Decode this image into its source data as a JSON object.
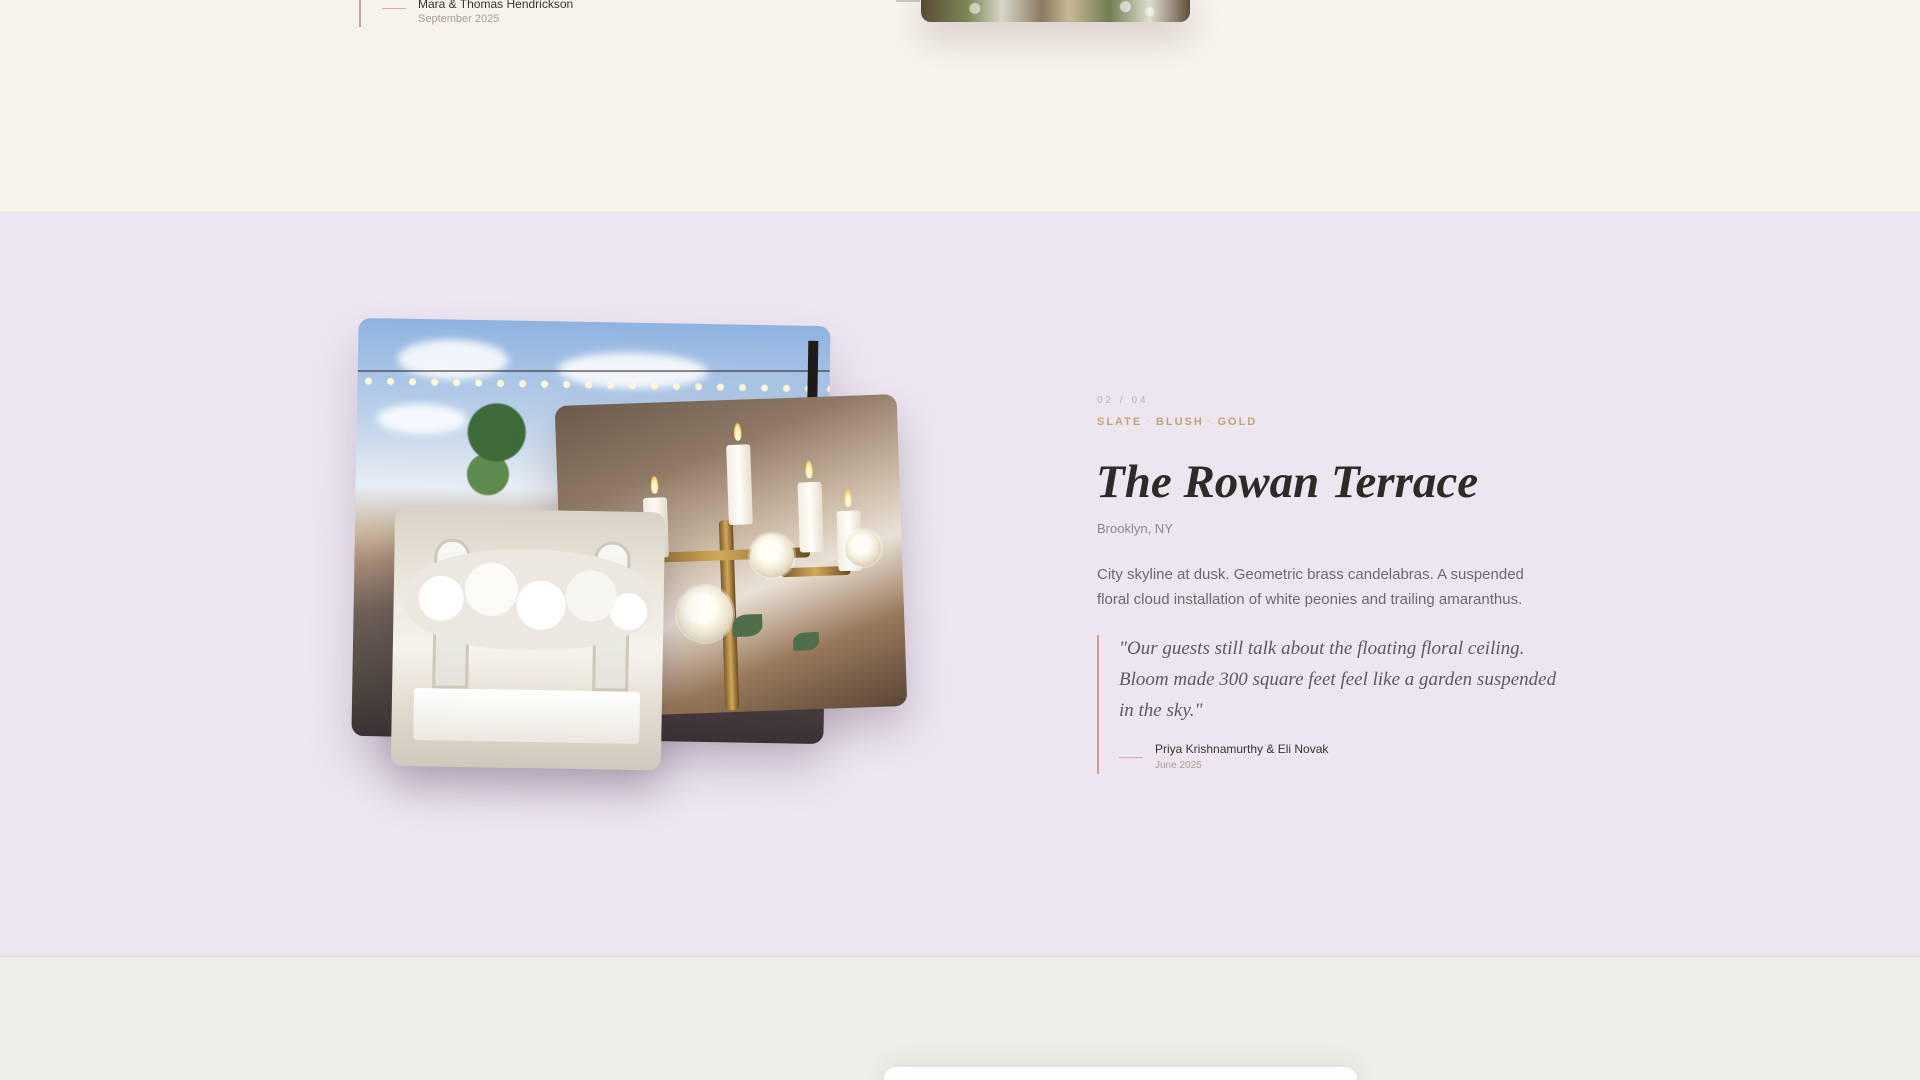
{
  "previous_testimonial": {
    "author": "Mara & Thomas Hendrickson",
    "date": "September 2025"
  },
  "venue": {
    "counter": "02 / 04",
    "palette": [
      "SLATE",
      "BLUSH",
      "GOLD"
    ],
    "palette_separator": "·",
    "name": "The Rowan Terrace",
    "location": "Brooklyn, NY",
    "description": "City skyline at dusk. Geometric brass candelabras. A suspended floral cloud installation of white peonies and trailing amaranthus.",
    "testimonial": {
      "quote": "\"Our guests still talk about the floating floral ceiling. Bloom made 300 square feet feel like a garden suspended in the sky.\"",
      "author": "Priya Krishnamurthy & Eli Novak",
      "date": "June 2025"
    },
    "photos": [
      "rooftop-terrace-photo",
      "candelabra-table-photo",
      "floral-ceiling-hall-photo"
    ]
  },
  "colors": {
    "cream_section": "#f6f2ec",
    "lavender_section": "#ede6f1",
    "sage_section": "#efeee8",
    "accent_gold": "#c3a678",
    "quote_rule": "#cf9c9c"
  }
}
